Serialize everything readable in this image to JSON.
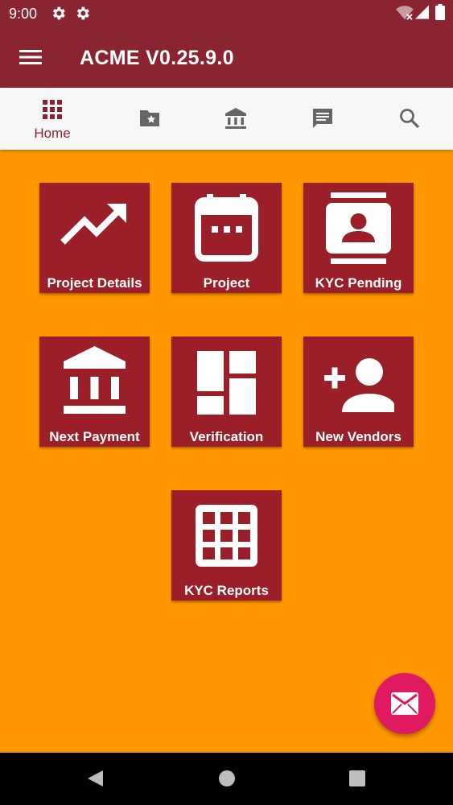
{
  "status_bar": {
    "time": "9:00"
  },
  "app_bar": {
    "title": "ACME V0.25.9.0"
  },
  "tabs": [
    {
      "label": "Home",
      "icon": "grid-icon",
      "selected": true
    },
    {
      "label": "",
      "icon": "folder-star-icon"
    },
    {
      "label": "",
      "icon": "bank-icon"
    },
    {
      "label": "",
      "icon": "message-icon"
    },
    {
      "label": "",
      "icon": "search-icon"
    }
  ],
  "tiles": [
    {
      "label": "Project Details",
      "icon": "trending-up-icon"
    },
    {
      "label": "Project",
      "icon": "calendar-icon"
    },
    {
      "label": "KYC Pending",
      "icon": "contact-card-icon"
    },
    {
      "label": "Next Payment",
      "icon": "bank-icon"
    },
    {
      "label": "Verification",
      "icon": "dashboard-icon"
    },
    {
      "label": "New Vendors",
      "icon": "person-add-icon"
    },
    {
      "label": "KYC Reports",
      "icon": "grid-icon"
    }
  ],
  "fab": {
    "icon": "mail-icon"
  },
  "colors": {
    "primary": "#8b2431",
    "tile": "#9b1f28",
    "background": "#ff9800",
    "fab": "#e01a60"
  }
}
